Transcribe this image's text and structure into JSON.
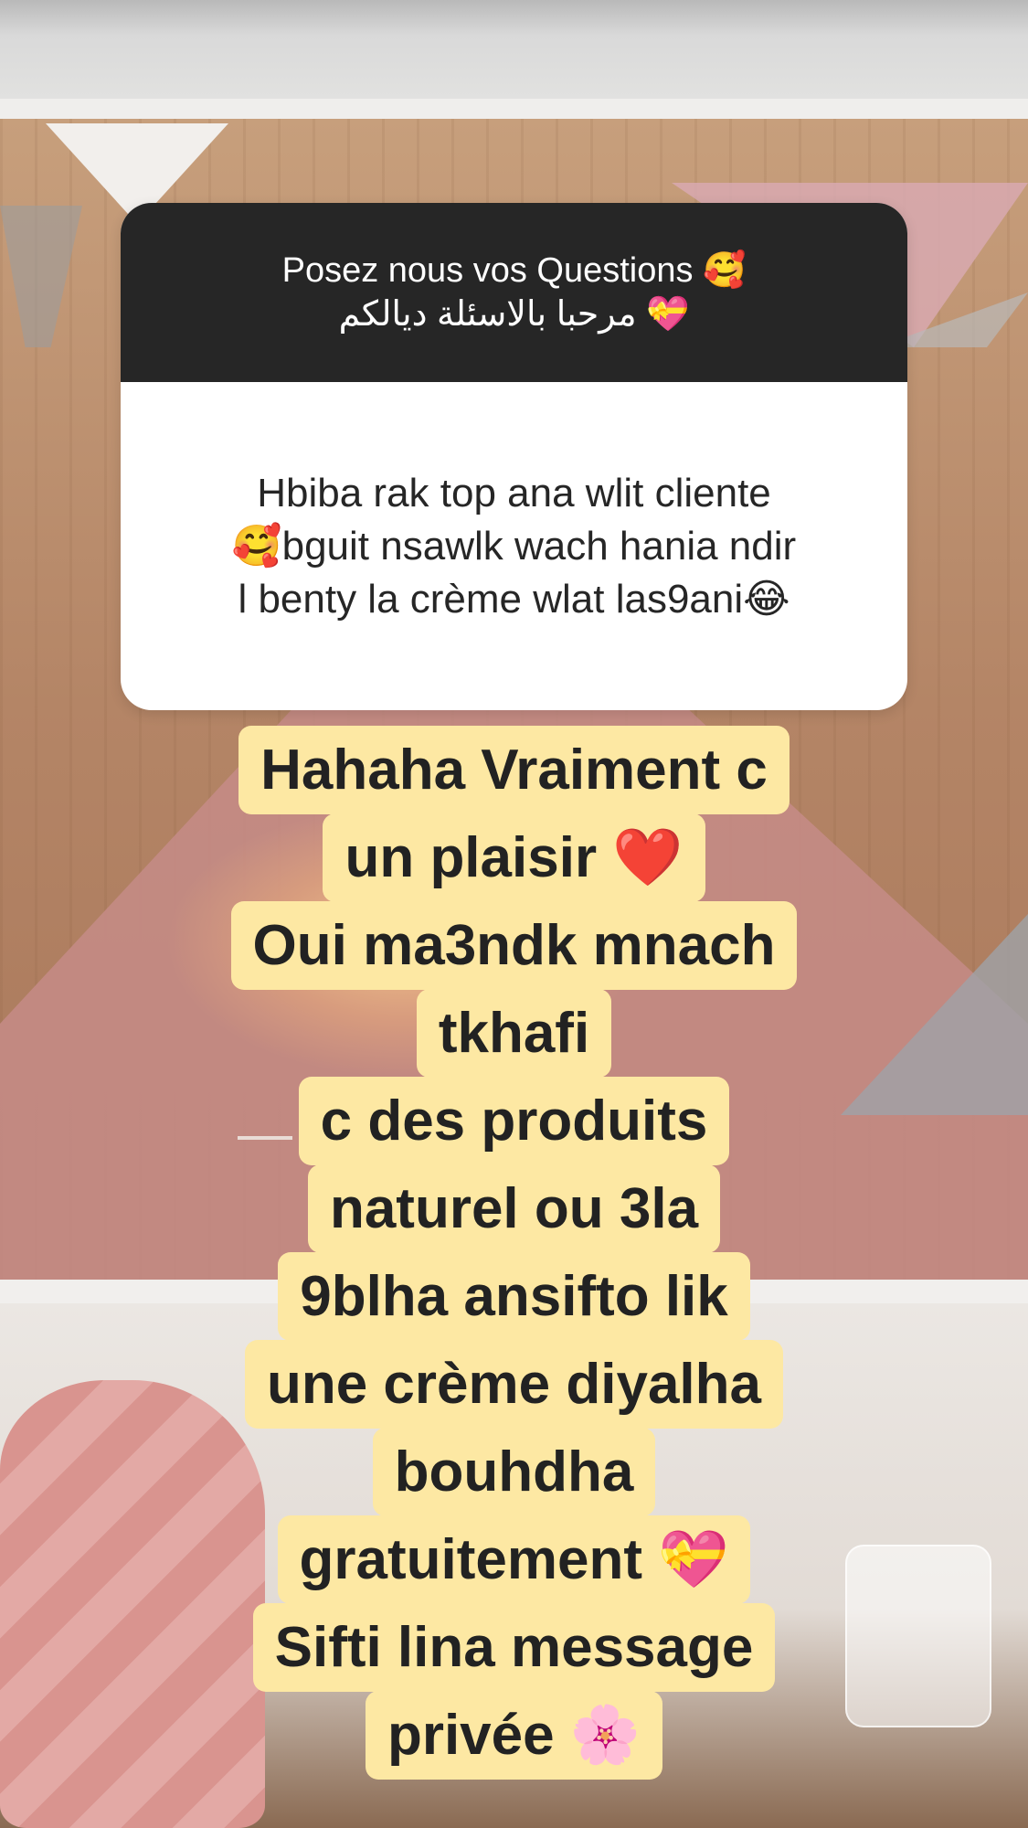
{
  "question_sticker": {
    "title_line1": "Posez nous vos Questions 🥰",
    "title_line2": "مرحبا بالاسئلة ديالكم 💝",
    "question_lines": [
      "Hbiba rak top ana wlit cliente",
      "🥰bguit nsawlk wach hania ndir",
      "l benty la crème wlat las9ani😂"
    ]
  },
  "answer": {
    "lines": [
      "Hahaha Vraiment c",
      "un plaisir ❤️",
      "Oui ma3ndk mnach",
      "tkhafi",
      "c des produits",
      "naturel ou 3la",
      "9blha ansifto lik",
      "une crème diyalha",
      "bouhdha",
      "gratuitement 💝",
      "Sifti lina message",
      "privée 🌸"
    ],
    "highlight_color": "#fde8a3"
  }
}
